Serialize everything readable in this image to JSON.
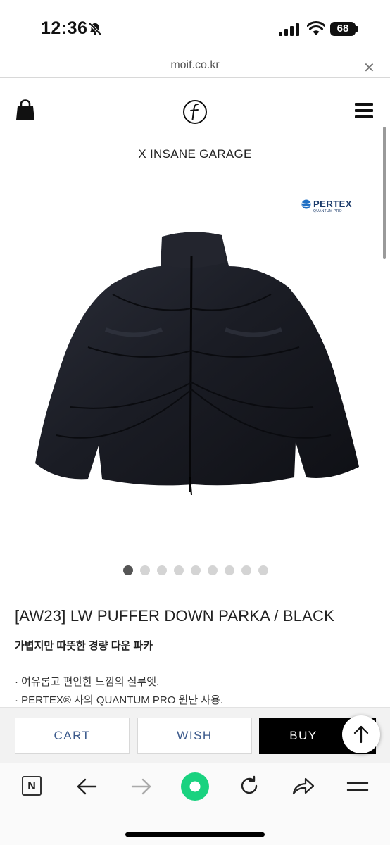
{
  "status_bar": {
    "time": "12:36",
    "battery": "68",
    "icons": [
      "bell-slash-icon",
      "signal-icon",
      "wifi-icon"
    ]
  },
  "browser": {
    "url": "moif.co.kr",
    "close_symbol": "✕"
  },
  "site_header": {
    "collab": "X INSANE GARAGE",
    "icons": [
      "shopping-bag-icon",
      "brand-logo",
      "hamburger-menu-icon"
    ]
  },
  "product": {
    "badge": {
      "brand": "PERTEX",
      "sub": "QUANTUM PRO"
    },
    "carousel": {
      "count": 9,
      "active_index": 0
    },
    "title": "[AW23] LW PUFFER DOWN PARKA / BLACK",
    "subtitle": "가볍지만 따뜻한 경량 다운 파카",
    "description": [
      "· 여유롭고 편안한 느낌의 실루엣.",
      "· PERTEX® 사의 QUANTUM PRO 원단 사용."
    ]
  },
  "actions": {
    "cart": "CART",
    "wish": "WISH",
    "buy": "BUY"
  },
  "bottom_bar": {
    "n_label": "N",
    "icons": [
      "back-arrow-icon",
      "forward-arrow-icon",
      "green-home-icon",
      "reload-icon",
      "share-icon",
      "menu-icon"
    ]
  },
  "colors": {
    "accent_green": "#19d27f",
    "button_text": "#3c5a8c",
    "buy_bg": "#000000"
  }
}
